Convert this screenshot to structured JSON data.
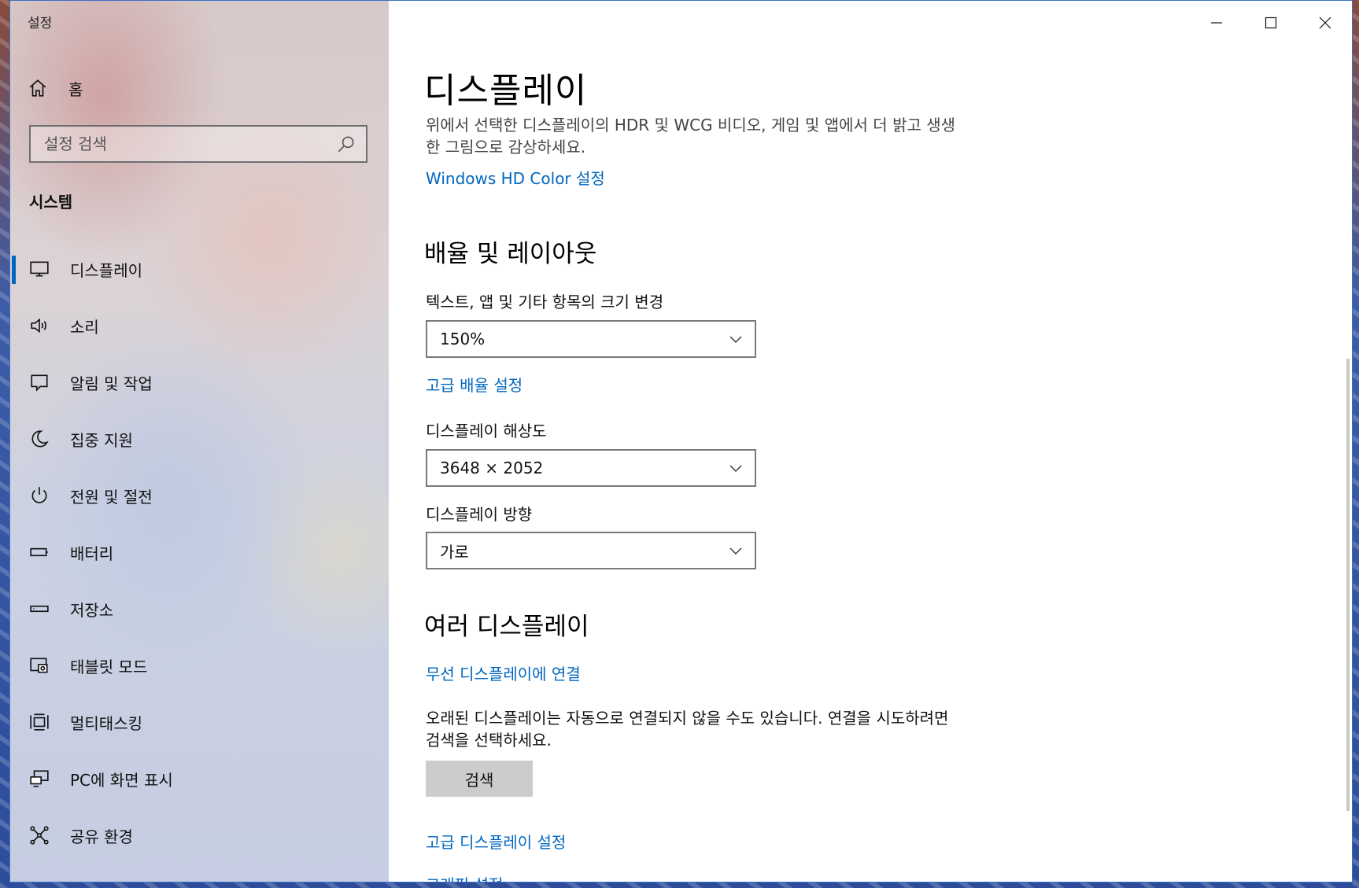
{
  "window": {
    "title": "설정"
  },
  "sidebar": {
    "home_label": "홈",
    "search": {
      "placeholder": "설정 검색"
    },
    "section_title": "시스템",
    "items": [
      {
        "label": "디스플레이",
        "icon": "monitor-icon",
        "active": true
      },
      {
        "label": "소리",
        "icon": "speaker-icon"
      },
      {
        "label": "알림 및 작업",
        "icon": "notification-icon"
      },
      {
        "label": "집중 지원",
        "icon": "moon-icon"
      },
      {
        "label": "전원 및 절전",
        "icon": "power-icon"
      },
      {
        "label": "배터리",
        "icon": "battery-icon"
      },
      {
        "label": "저장소",
        "icon": "storage-icon"
      },
      {
        "label": "태블릿 모드",
        "icon": "tablet-mode-icon"
      },
      {
        "label": "멀티태스킹",
        "icon": "multitasking-icon"
      },
      {
        "label": "PC에 화면 표시",
        "icon": "project-icon"
      },
      {
        "label": "공유 환경",
        "icon": "shared-experiences-icon"
      }
    ]
  },
  "main": {
    "title": "디스플레이",
    "hdr_description": "위에서 선택한 디스플레이의 HDR 및 WCG 비디오, 게임 및 앱에서 더 밝고 생생한 그림으로 감상하세요.",
    "hdr_link": "Windows HD Color 설정",
    "scale_section": {
      "heading": "배율 및 레이아웃",
      "scale_label": "텍스트, 앱 및 기타 항목의 크기 변경",
      "scale_value": "150%",
      "advanced_scaling_link": "고급 배율 설정",
      "resolution_label": "디스플레이 해상도",
      "resolution_value": "3648 × 2052",
      "orientation_label": "디스플레이 방향",
      "orientation_value": "가로"
    },
    "multi_section": {
      "heading": "여러 디스플레이",
      "wireless_link": "무선 디스플레이에 연결",
      "note": "오래된 디스플레이는 자동으로 연결되지 않을 수도 있습니다. 연결을 시도하려면 검색을 선택하세요.",
      "detect_button": "검색",
      "advanced_display_link": "고급 디스플레이 설정",
      "graphics_link": "그래픽 설정"
    }
  },
  "colors": {
    "accent": "#0067c0",
    "button_bg": "#cccccc"
  }
}
